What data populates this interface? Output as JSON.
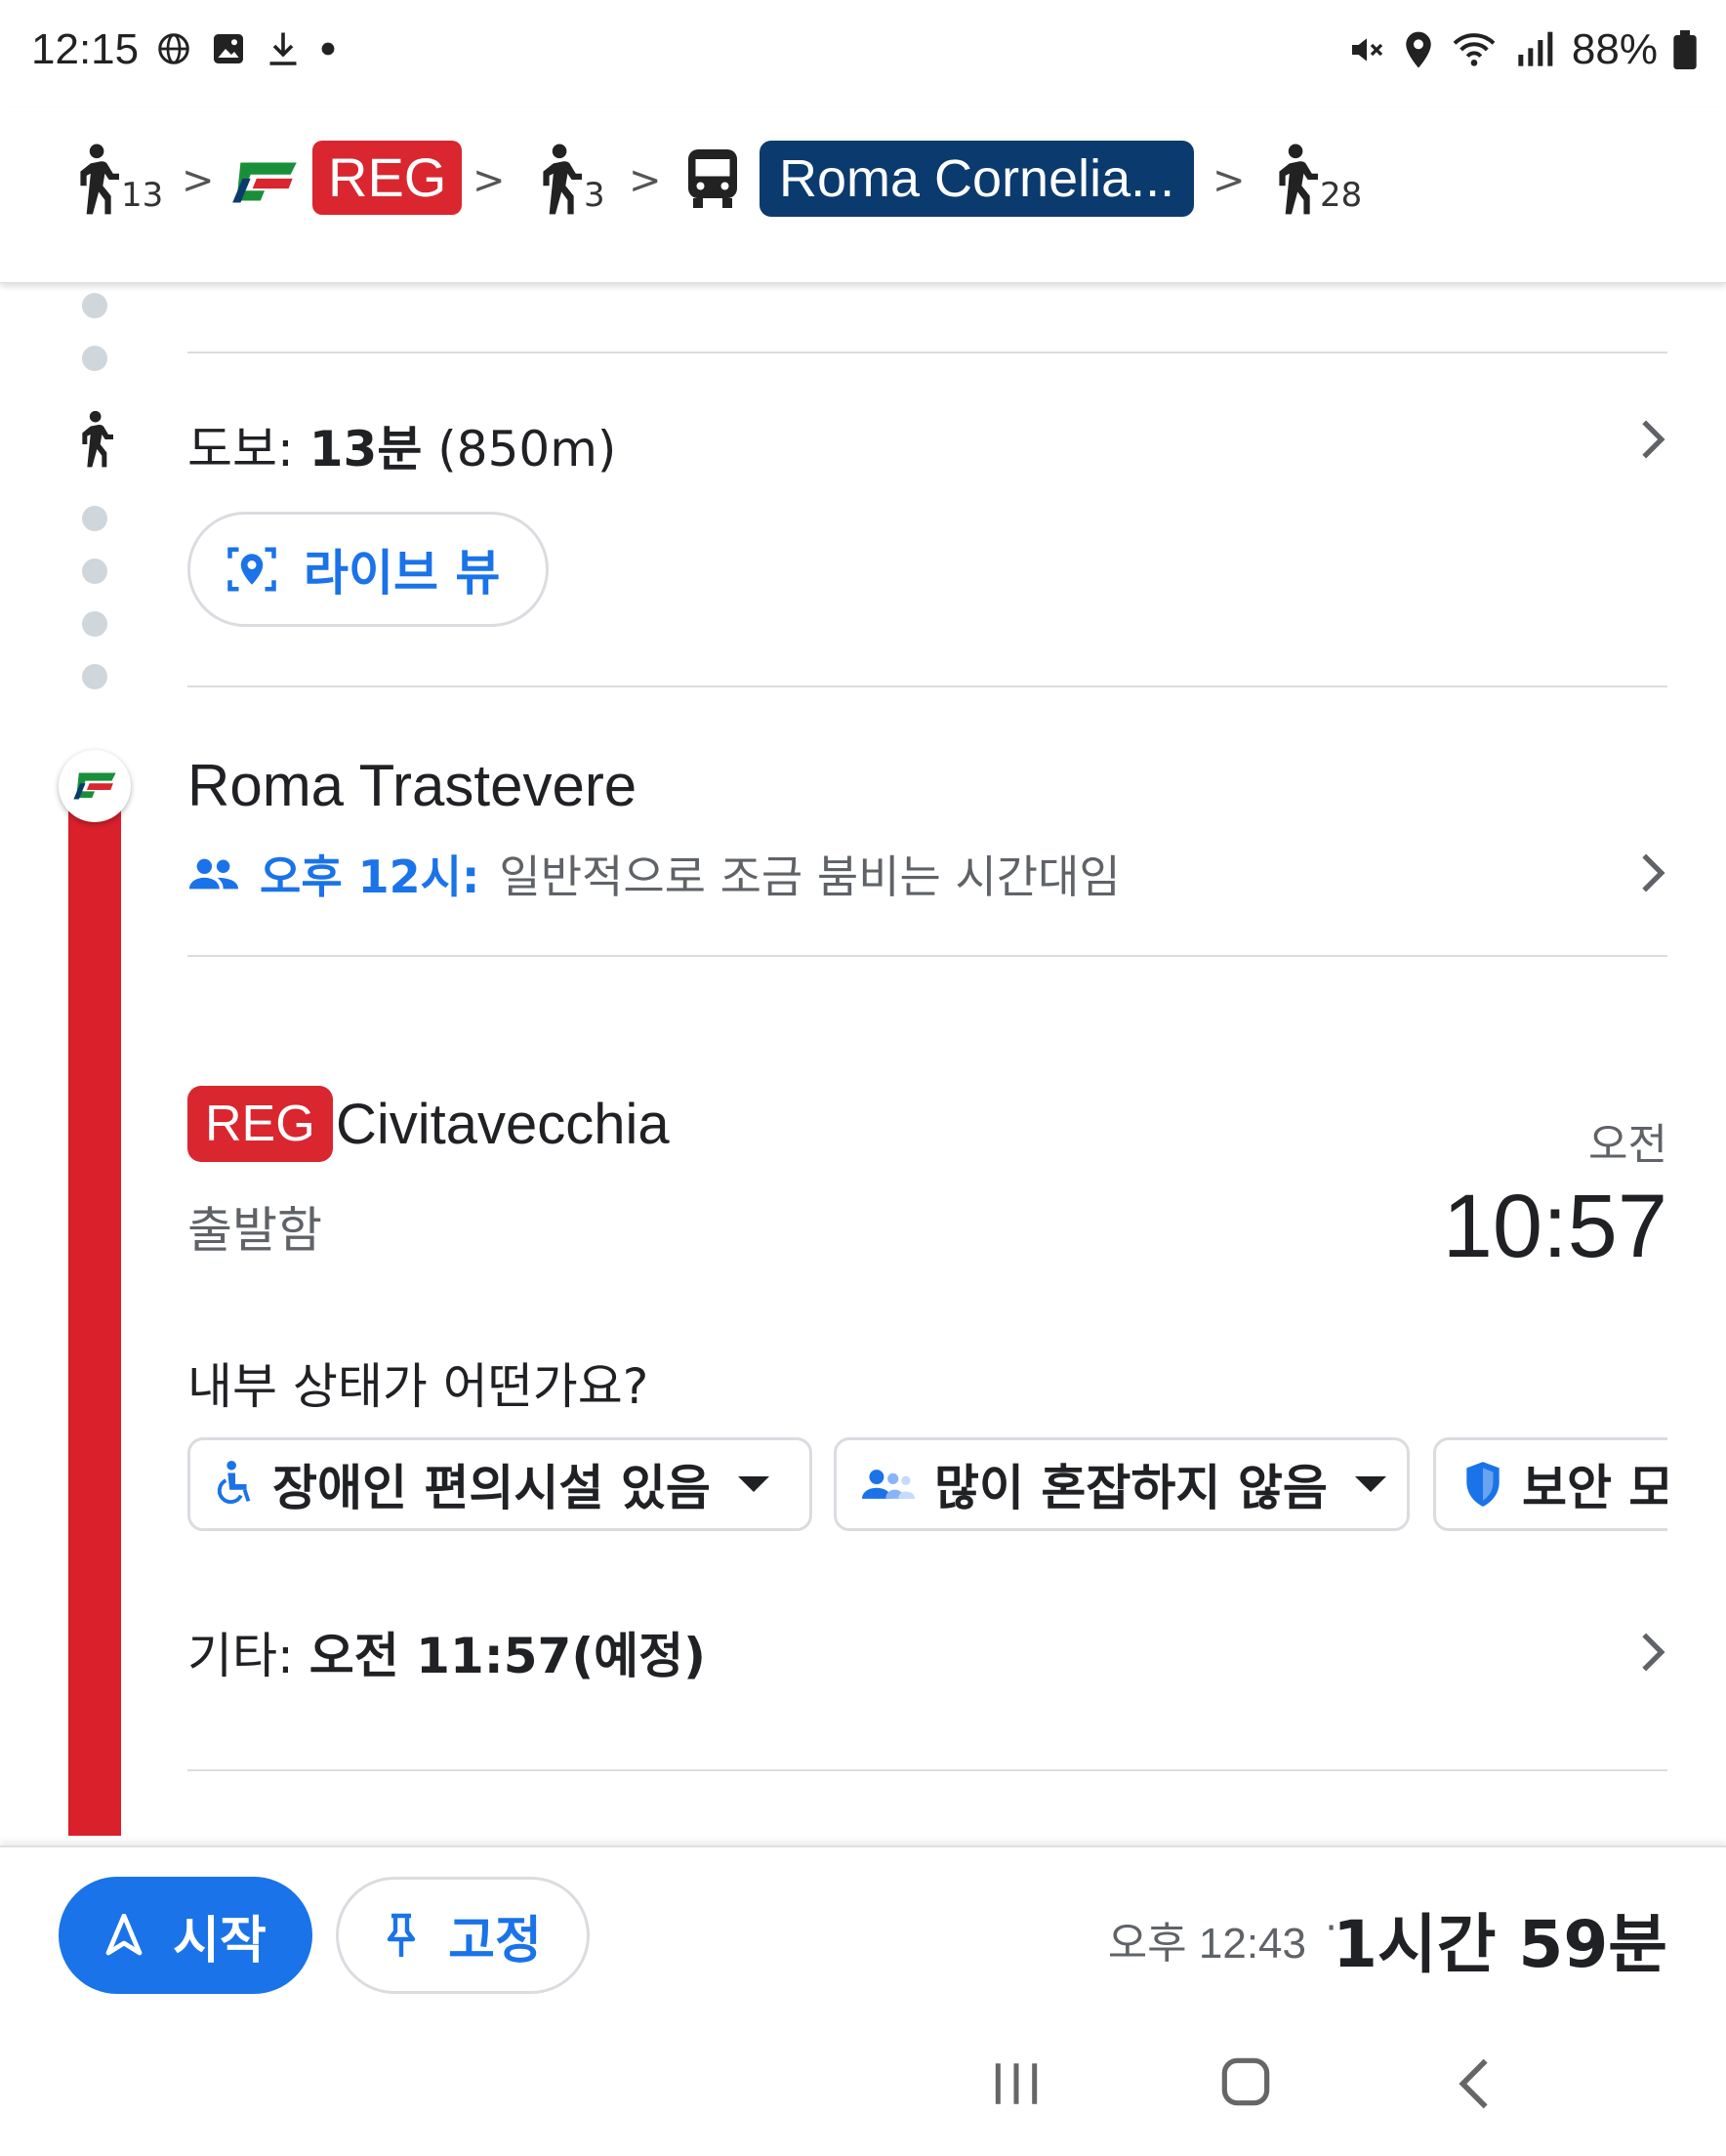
{
  "status_bar": {
    "time": "12:15",
    "battery": "88%"
  },
  "route_summary": {
    "walk1_minutes": "13",
    "train_badge": "REG",
    "walk2_minutes": "3",
    "bus_badge": "Roma Cornelia...",
    "walk3_minutes": "28",
    "separator": ">"
  },
  "walk_step": {
    "label": "도보:",
    "duration": "13분",
    "distance": "(850m)",
    "live_view_label": "라이브 뷰"
  },
  "station": {
    "name": "Roma Trastevere",
    "crowd_time": "오후 12시:",
    "crowd_text": "일반적으로 조금 붐비는 시간대임"
  },
  "train": {
    "badge": "REG",
    "destination": "Civitavecchia",
    "status": "출발함",
    "ampm": "오전",
    "departure_time": "10:57",
    "question": "내부 상태가 어떤가요?",
    "chips": [
      {
        "label": "장애인 편의시설 있음",
        "icon": "accessible-icon"
      },
      {
        "label": "많이 혼잡하지 않음",
        "icon": "people-icon"
      },
      {
        "label": "보안 모",
        "icon": "shield-icon"
      }
    ],
    "other_label": "기타:",
    "other_time": "오전 11:57(예정)"
  },
  "bottom_bar": {
    "start_label": "시작",
    "pin_label": "고정",
    "arrival": "오후 12:43",
    "dot": "·",
    "duration": "1시간 59분"
  },
  "colors": {
    "accent_blue": "#1a73e8",
    "reg_red": "#d9262f",
    "bus_navy": "#0b3a6e",
    "timeline_red": "#d9202b"
  }
}
